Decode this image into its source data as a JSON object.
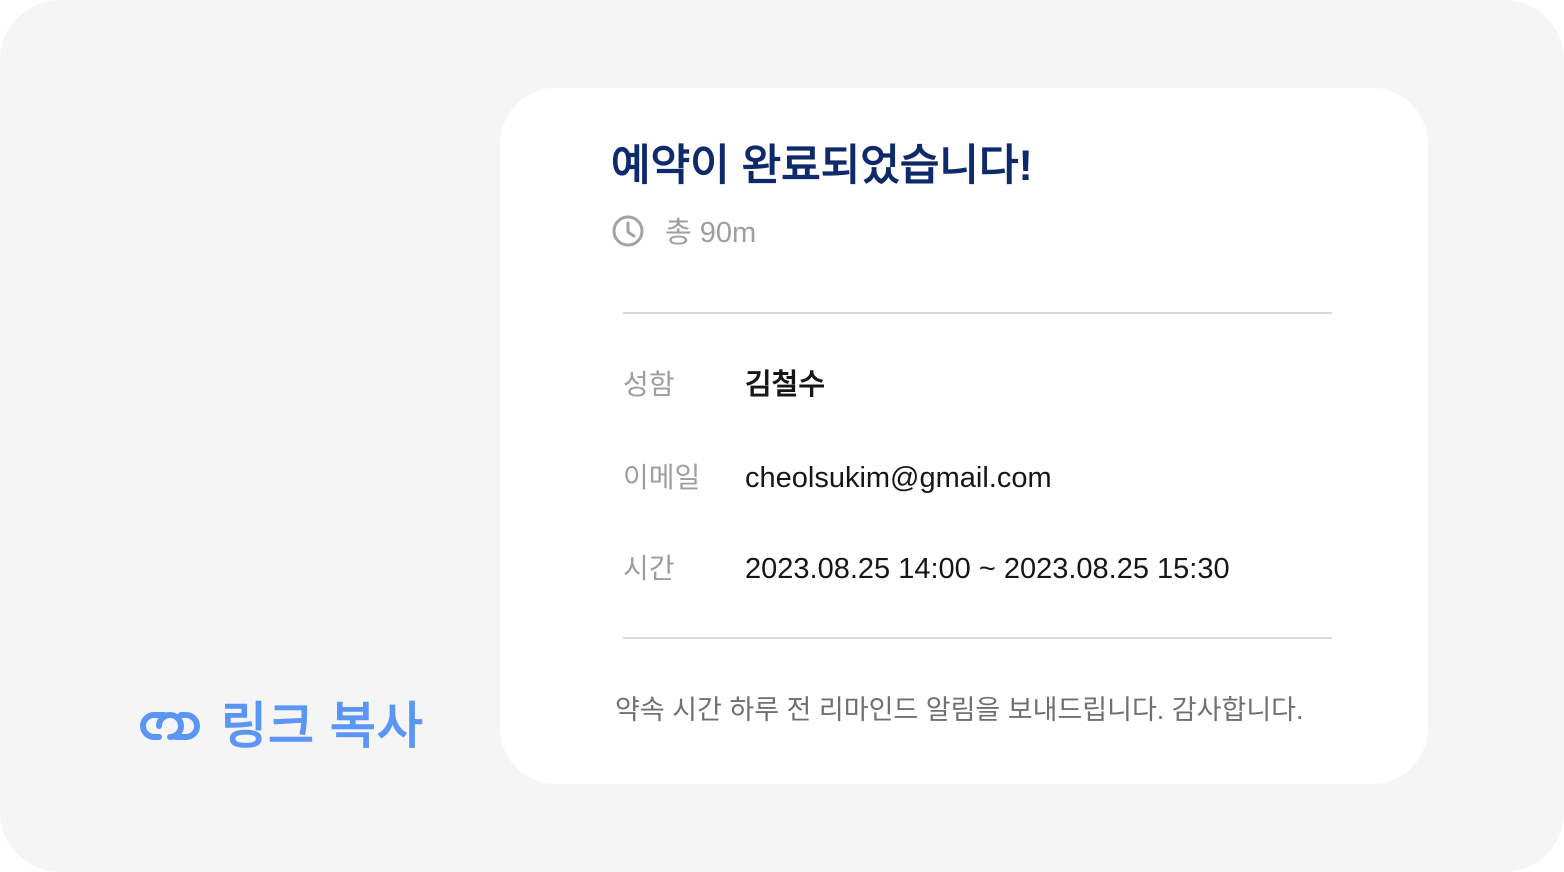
{
  "copy_link": {
    "icon": "link-icon",
    "label": "링크 복사",
    "color": "#5b95f5"
  },
  "confirmation": {
    "title": "예약이 완료되었습니다!",
    "title_color": "#0f2a6b",
    "duration": {
      "icon": "clock-icon",
      "text": "총 90m"
    },
    "details": [
      {
        "key": "성함",
        "value": "김철수"
      },
      {
        "key": "이메일",
        "value": "cheolsukim@gmail.com"
      },
      {
        "key": "시간",
        "value": "2023.08.25 14:00 ~ 2023.08.25 15:30"
      }
    ],
    "note": "약속 시간 하루 전 리마인드 알림을 보내드립니다. 감사합니다."
  }
}
